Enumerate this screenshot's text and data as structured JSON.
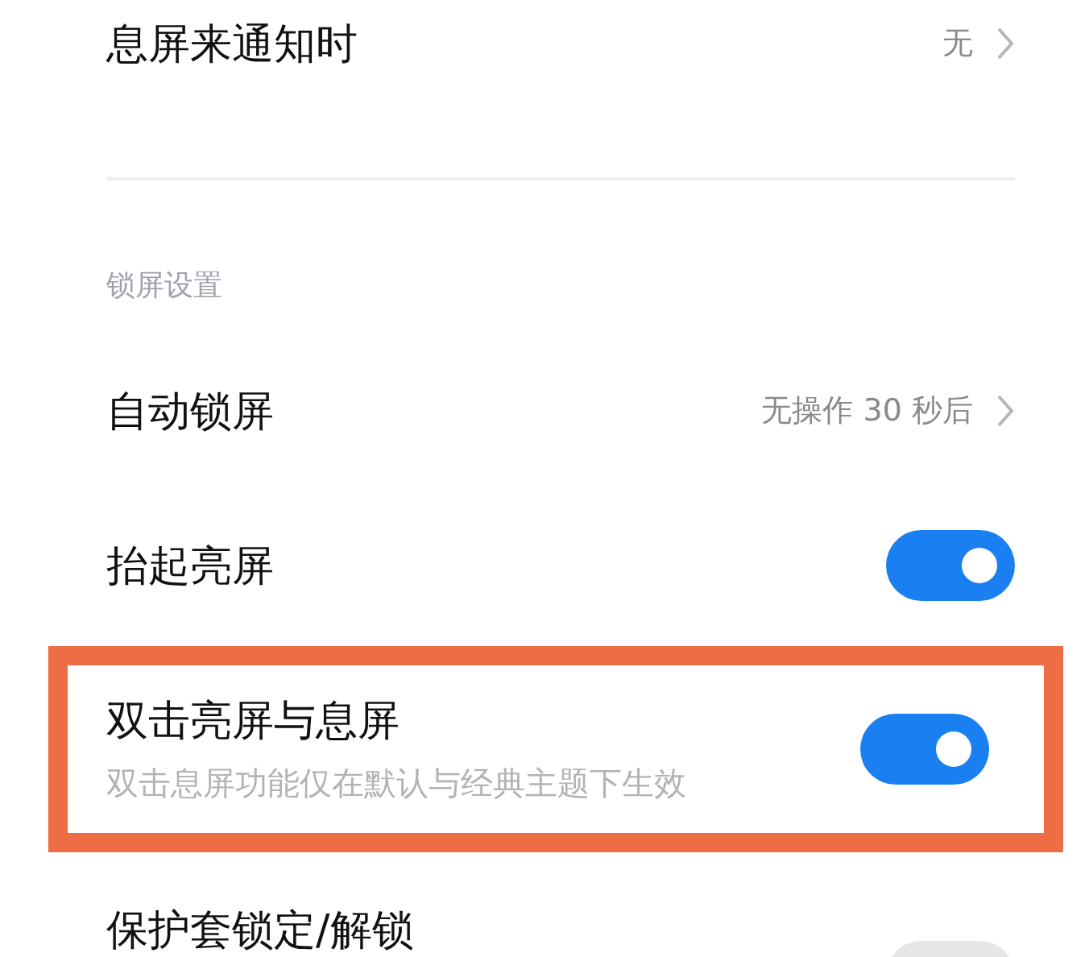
{
  "top_item": {
    "title": "息屏来通知时",
    "value": "无"
  },
  "section": {
    "header": "锁屏设置"
  },
  "items": [
    {
      "kind": "link",
      "title": "自动锁屏",
      "value": "无操作 30 秒后"
    },
    {
      "kind": "switch",
      "title": "抬起亮屏",
      "on": true
    },
    {
      "kind": "switch",
      "title": "双击亮屏与息屏",
      "subtitle": "双击息屏功能仅在默认与经典主题下生效",
      "on": true,
      "highlighted": true
    },
    {
      "kind": "switch",
      "title": "保护套锁定/解锁",
      "on": false
    }
  ]
}
